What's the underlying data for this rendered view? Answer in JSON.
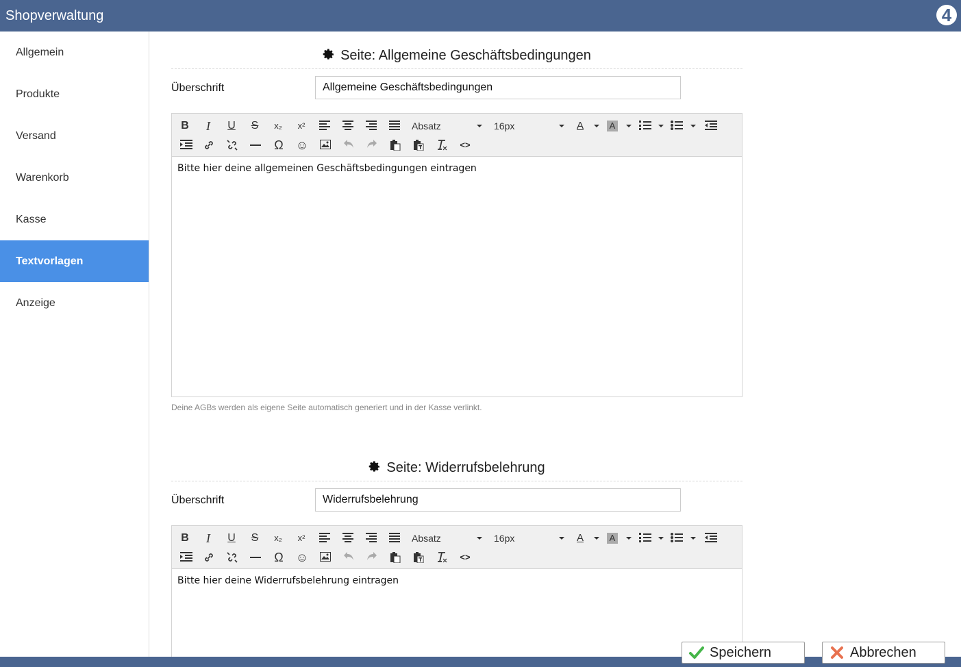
{
  "app": {
    "title": "Shopverwaltung",
    "logo_text": "4"
  },
  "sidebar": {
    "items": [
      {
        "label": "Allgemein",
        "active": false
      },
      {
        "label": "Produkte",
        "active": false
      },
      {
        "label": "Versand",
        "active": false
      },
      {
        "label": "Warenkorb",
        "active": false
      },
      {
        "label": "Kasse",
        "active": false
      },
      {
        "label": "Textvorlagen",
        "active": true
      },
      {
        "label": "Anzeige",
        "active": false
      }
    ]
  },
  "sections": [
    {
      "heading": "Seite: Allgemeine Geschäftsbedingungen",
      "field_label": "Überschrift",
      "field_value": "Allgemeine Geschäftsbedingungen",
      "format_select": "Absatz",
      "size_select": "16px",
      "body_text": "Bitte hier deine allgemeinen Geschäftsbedingungen eintragen",
      "hint": "Deine AGBs werden als eigene Seite automatisch generiert und in der Kasse verlinkt."
    },
    {
      "heading": "Seite: Widerrufsbelehrung",
      "field_label": "Überschrift",
      "field_value": "Widerrufsbelehrung",
      "format_select": "Absatz",
      "size_select": "16px",
      "body_text": "Bitte hier deine Widerrufsbelehrung eintragen"
    }
  ],
  "toolbar_glyphs": {
    "bold": "B",
    "italic": "I",
    "underline": "U",
    "strike": "S",
    "subscript": "x₂",
    "superscript": "x²",
    "omega": "Ω",
    "smiley": "☺",
    "code": "<>",
    "text_color": "A",
    "bg_color": "A"
  },
  "footer": {
    "save_label": "Speichern",
    "cancel_label": "Abbrechen"
  },
  "colors": {
    "header": "#4a6590",
    "active": "#4a90e6",
    "save": "#45b649",
    "cancel": "#e8714f"
  }
}
